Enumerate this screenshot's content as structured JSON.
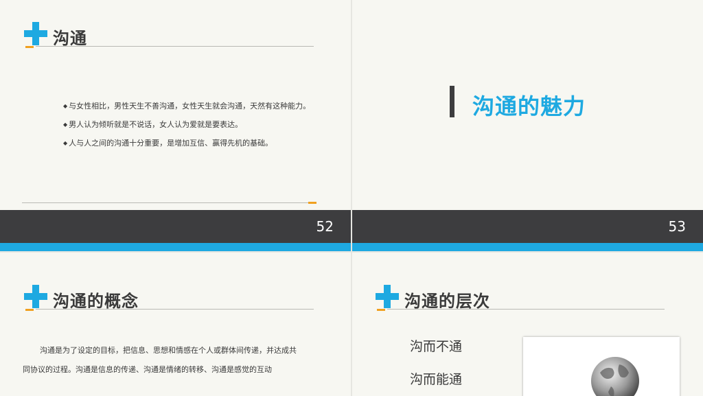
{
  "slide1": {
    "title": "沟通",
    "bullets": [
      "与女性相比，男性天生不善沟通，女性天生就会沟通，天然有这种能力。",
      "男人认为倾听就是不说话，女人认为爱就是要表达。",
      "人与人之间的沟通十分重要，是增加互信、赢得先机的基础。"
    ],
    "bullet_symbol": "◆",
    "page_number": "52"
  },
  "slide2": {
    "title": "沟通的魅力",
    "page_number": "53"
  },
  "slide3": {
    "title": "沟通的概念",
    "paragraph_line1": "沟通是为了设定的目标，把信息、思想和情感在个人或群体间传递，并达成共",
    "paragraph_line2": "同协议的过程。沟通是信息的传递、沟通是情绪的转移、沟通是感觉的互动"
  },
  "slide4": {
    "title": "沟通的层次",
    "levels": [
      "沟而不通",
      "沟而能通"
    ]
  },
  "colors": {
    "accent_blue": "#1ea9e1",
    "accent_orange": "#f0a020",
    "footer_dark": "#3d3d3f",
    "slide_bg": "#f7f7f2"
  }
}
